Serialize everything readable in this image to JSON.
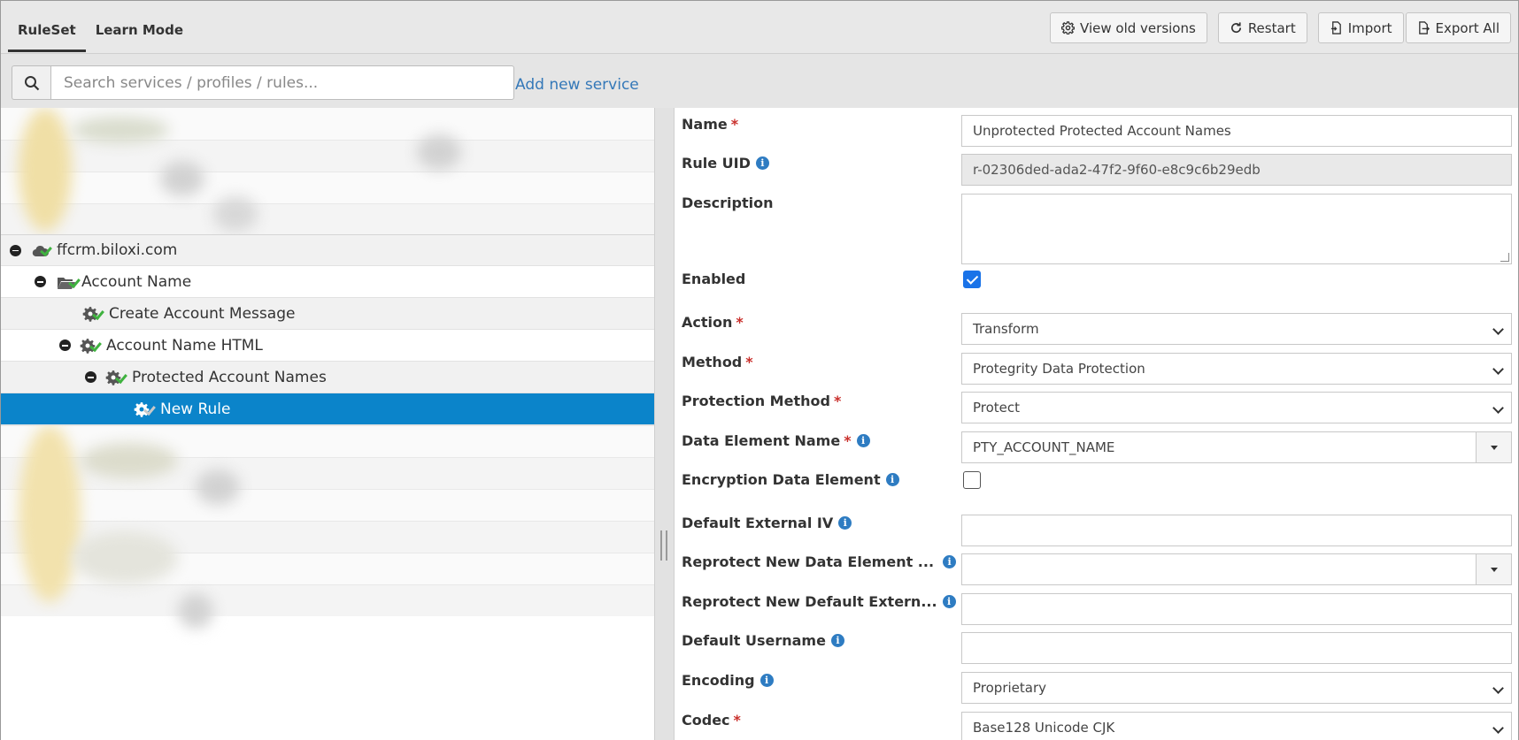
{
  "tabs": [
    {
      "label": "RuleSet",
      "active": true
    },
    {
      "label": "Learn Mode",
      "active": false
    }
  ],
  "toolbar": {
    "view_old_versions": "View old versions",
    "restart": "Restart",
    "import": "Import",
    "export_all": "Export All"
  },
  "search": {
    "placeholder": "Search services / profiles / rules...",
    "value": ""
  },
  "add_service_link": "Add new service",
  "tree": {
    "items": [
      {
        "label": "ffcrm.biloxi.com"
      },
      {
        "label": "Account Name"
      },
      {
        "label": "Create Account Message"
      },
      {
        "label": "Account Name HTML"
      },
      {
        "label": "Protected Account Names"
      },
      {
        "label": "New Rule"
      }
    ]
  },
  "form": {
    "name": {
      "label": "Name",
      "value": "Unprotected Protected Account Names"
    },
    "rule_uid": {
      "label": "Rule UID",
      "value": "r-02306ded-ada2-47f2-9f60-e8c9c6b29edb"
    },
    "description": {
      "label": "Description",
      "value": ""
    },
    "enabled": {
      "label": "Enabled",
      "checked": true
    },
    "action": {
      "label": "Action",
      "value": "Transform"
    },
    "method": {
      "label": "Method",
      "value": "Protegrity Data Protection"
    },
    "protection_method": {
      "label": "Protection Method",
      "value": "Protect"
    },
    "data_element_name": {
      "label": "Data Element Name",
      "value": "PTY_ACCOUNT_NAME"
    },
    "encryption_data_element": {
      "label": "Encryption Data Element",
      "checked": false
    },
    "default_external_iv": {
      "label": "Default External IV",
      "value": ""
    },
    "reprotect_new_data_element": {
      "label": "Reprotect New Data Element ...",
      "value": ""
    },
    "reprotect_new_default_extern": {
      "label": "Reprotect New Default Extern...",
      "value": ""
    },
    "default_username": {
      "label": "Default Username",
      "value": ""
    },
    "encoding": {
      "label": "Encoding",
      "value": "Proprietary"
    },
    "codec": {
      "label": "Codec",
      "value": "Base128 Unicode CJK"
    },
    "required_mark": "*",
    "info_glyph": "i"
  },
  "colors": {
    "selected_row": "#0b84ca",
    "link": "#3478b8",
    "required": "#c9302c",
    "check": "#3fb23f",
    "info": "#2e7cc2"
  },
  "icons": {
    "search": "search-icon",
    "gear": "gear-icon",
    "restart": "refresh-icon",
    "import": "file-import-icon",
    "export": "file-export-icon",
    "cloud": "cloud-icon",
    "folder": "folder-open-icon",
    "check": "check-icon",
    "collapse": "minus-circle-icon"
  }
}
